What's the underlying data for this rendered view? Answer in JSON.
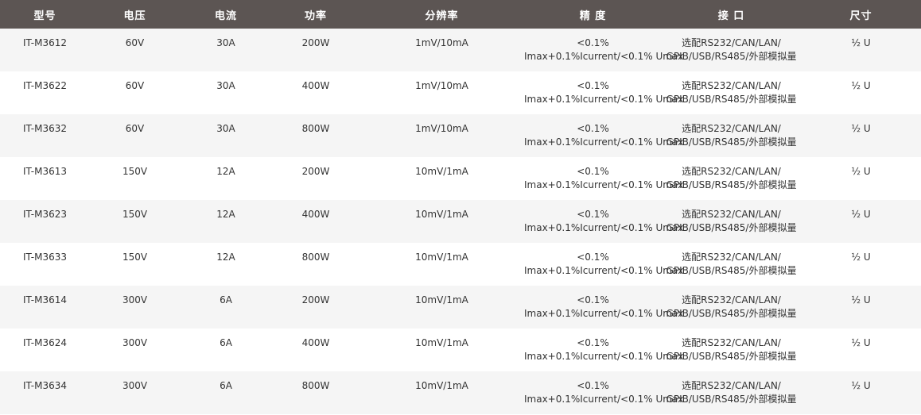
{
  "headers": [
    "型号",
    "电压",
    "电流",
    "功率",
    "分辨率",
    "精 度",
    "接 口",
    "尺寸"
  ],
  "rows": [
    {
      "model": "IT-M3612",
      "voltage": "60V",
      "current": "30A",
      "power": "200W",
      "resolution": "1mV/10mA",
      "accuracy_1": "<0.1%",
      "accuracy_2": "Imax+0.1%Icurrent/<0.1% Umax",
      "interface_1": "选配RS232/CAN/LAN/",
      "interface_2": "GPIB/USB/RS485/外部模拟量",
      "size": "½ U"
    },
    {
      "model": "IT-M3622",
      "voltage": "60V",
      "current": "30A",
      "power": "400W",
      "resolution": "1mV/10mA",
      "accuracy_1": "<0.1%",
      "accuracy_2": "Imax+0.1%Icurrent/<0.1% Umax",
      "interface_1": "选配RS232/CAN/LAN/",
      "interface_2": "GPIB/USB/RS485/外部模拟量",
      "size": "½ U"
    },
    {
      "model": "IT-M3632",
      "voltage": "60V",
      "current": "30A",
      "power": "800W",
      "resolution": "1mV/10mA",
      "accuracy_1": "<0.1%",
      "accuracy_2": "Imax+0.1%Icurrent/<0.1% Umax",
      "interface_1": "选配RS232/CAN/LAN/",
      "interface_2": "GPIB/USB/RS485/外部模拟量",
      "size": "½ U"
    },
    {
      "model": "IT-M3613",
      "voltage": "150V",
      "current": "12A",
      "power": "200W",
      "resolution": "10mV/1mA",
      "accuracy_1": "<0.1%",
      "accuracy_2": "Imax+0.1%Icurrent/<0.1% Umax",
      "interface_1": "选配RS232/CAN/LAN/",
      "interface_2": "GPIB/USB/RS485/外部模拟量",
      "size": "½ U"
    },
    {
      "model": "IT-M3623",
      "voltage": "150V",
      "current": "12A",
      "power": "400W",
      "resolution": "10mV/1mA",
      "accuracy_1": "<0.1%",
      "accuracy_2": "Imax+0.1%Icurrent/<0.1% Umax",
      "interface_1": "选配RS232/CAN/LAN/",
      "interface_2": "GPIB/USB/RS485/外部模拟量",
      "size": "½ U"
    },
    {
      "model": "IT-M3633",
      "voltage": "150V",
      "current": "12A",
      "power": "800W",
      "resolution": "10mV/1mA",
      "accuracy_1": "<0.1%",
      "accuracy_2": "Imax+0.1%Icurrent/<0.1% Umax",
      "interface_1": "选配RS232/CAN/LAN/",
      "interface_2": "GPIB/USB/RS485/外部模拟量",
      "size": "½ U"
    },
    {
      "model": "IT-M3614",
      "voltage": "300V",
      "current": "6A",
      "power": "200W",
      "resolution": "10mV/1mA",
      "accuracy_1": "<0.1%",
      "accuracy_2": "Imax+0.1%Icurrent/<0.1% Umax",
      "interface_1": "选配RS232/CAN/LAN/",
      "interface_2": "GPIB/USB/RS485/外部模拟量",
      "size": "½ U"
    },
    {
      "model": "IT-M3624",
      "voltage": "300V",
      "current": "6A",
      "power": "400W",
      "resolution": "10mV/1mA",
      "accuracy_1": "<0.1%",
      "accuracy_2": "Imax+0.1%Icurrent/<0.1% Umax",
      "interface_1": "选配RS232/CAN/LAN/",
      "interface_2": "GPIB/USB/RS485/外部模拟量",
      "size": "½ U"
    },
    {
      "model": "IT-M3634",
      "voltage": "300V",
      "current": "6A",
      "power": "800W",
      "resolution": "10mV/1mA",
      "accuracy_1": "<0.1%",
      "accuracy_2": "Imax+0.1%Icurrent/<0.1% Umax",
      "interface_1": "选配RS232/CAN/LAN/",
      "interface_2": "GPIB/USB/RS485/外部模拟量",
      "size": "½ U"
    }
  ],
  "colors": {
    "header_bg": "#5c5553",
    "header_text": "#ffffff",
    "row_alt_bg": "#f5f5f5",
    "row_bg": "#ffffff",
    "body_text": "#333333"
  }
}
